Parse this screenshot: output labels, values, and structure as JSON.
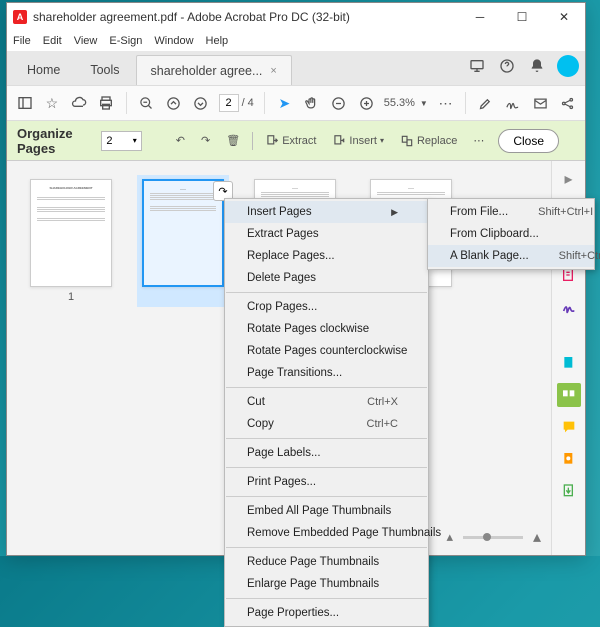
{
  "titlebar": {
    "app_icon_letter": "A",
    "title": "shareholder agreement.pdf - Adobe Acrobat Pro DC (32-bit)"
  },
  "menubar": [
    "File",
    "Edit",
    "View",
    "E-Sign",
    "Window",
    "Help"
  ],
  "tabs": {
    "home": "Home",
    "tools": "Tools",
    "doc": "shareholder agree...",
    "close": "×"
  },
  "toolbar": {
    "page_current": "2",
    "page_total": "4",
    "zoom": "55.3%"
  },
  "organize": {
    "title": "Organize Pages",
    "page_sel": "2",
    "extract": "Extract",
    "insert": "Insert",
    "replace": "Replace",
    "close": "Close"
  },
  "thumbs": {
    "label1": "1"
  },
  "ctx_main": [
    {
      "t": "item",
      "label": "Insert Pages",
      "submenu": true,
      "hover": true
    },
    {
      "t": "item",
      "label": "Extract Pages"
    },
    {
      "t": "item",
      "label": "Replace Pages..."
    },
    {
      "t": "item",
      "label": "Delete Pages"
    },
    {
      "t": "div"
    },
    {
      "t": "item",
      "label": "Crop Pages..."
    },
    {
      "t": "item",
      "label": "Rotate Pages clockwise"
    },
    {
      "t": "item",
      "label": "Rotate Pages counterclockwise"
    },
    {
      "t": "item",
      "label": "Page Transitions..."
    },
    {
      "t": "div"
    },
    {
      "t": "item",
      "label": "Cut",
      "hk": "Ctrl+X"
    },
    {
      "t": "item",
      "label": "Copy",
      "hk": "Ctrl+C"
    },
    {
      "t": "div"
    },
    {
      "t": "item",
      "label": "Page Labels..."
    },
    {
      "t": "div"
    },
    {
      "t": "item",
      "label": "Print Pages..."
    },
    {
      "t": "div"
    },
    {
      "t": "item",
      "label": "Embed All Page Thumbnails"
    },
    {
      "t": "item",
      "label": "Remove Embedded Page Thumbnails"
    },
    {
      "t": "div"
    },
    {
      "t": "item",
      "label": "Reduce Page Thumbnails"
    },
    {
      "t": "item",
      "label": "Enlarge Page Thumbnails"
    },
    {
      "t": "div"
    },
    {
      "t": "item",
      "label": "Page Properties..."
    }
  ],
  "ctx_sub": [
    {
      "label": "From File...",
      "hk": "Shift+Ctrl+I"
    },
    {
      "label": "From Clipboard..."
    },
    {
      "label": "A Blank Page...",
      "hk": "Shift+Ctrl+T",
      "hover": true
    }
  ],
  "side_icons": [
    "create",
    "export",
    "edit",
    "sign",
    "more",
    "organize",
    "comment",
    "protect",
    "optimize"
  ]
}
